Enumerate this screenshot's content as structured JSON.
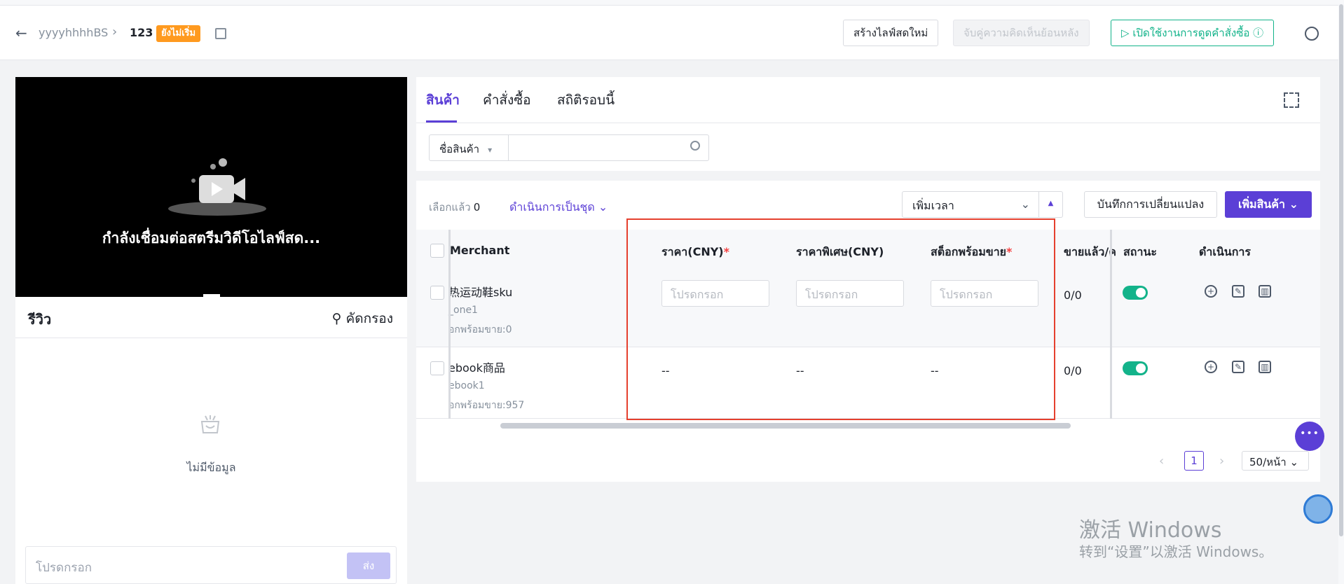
{
  "header": {
    "back_icon": "arrow-left-icon",
    "crumb_parent": "yyyyhhhhBS",
    "crumb_current": "123",
    "status_badge": "ยังไม่เริ่ม",
    "buttons": {
      "new_live": "สร้างไลฟ์สดใหม่",
      "match_feedback": "จับคู่ความคิดเห็นย้อนหลัง",
      "enable_order": "เปิดใช้งานการดูดคำสั่งซื้อ"
    }
  },
  "video": {
    "connecting_text": "กำลังเชื่อมต่อสตรีมวิดีโอไลฟ์สด..."
  },
  "review": {
    "title": "รีวิว",
    "filter_label": "คัดกรอง",
    "empty_text": "ไม่มีข้อมูล",
    "input_placeholder": "โปรดกรอก",
    "send_label": "ส่ง"
  },
  "tabs": [
    {
      "label": "สินค้า",
      "active": true
    },
    {
      "label": "คำสั่งซื้อ",
      "active": false
    },
    {
      "label": "สถิติรอบนี้",
      "active": false
    }
  ],
  "search": {
    "field_select": "ชื่อสินค้า",
    "value": ""
  },
  "toolbar": {
    "selected_label": "เลือกแล้ว",
    "selected_count": "0",
    "batch_label": "ดำเนินการเป็นชุด",
    "time_select": "เพิ่มเวลา",
    "save_label": "บันทึกการเปลี่ยนแปลง",
    "add_label": "เพิ่มสินค้า"
  },
  "table": {
    "columns": {
      "merchant": "Merchant",
      "price": "ราคา(CNY)",
      "special_price": "ราคาพิเศษ(CNY)",
      "stock": "สต็อกพร้อมขาย",
      "sold": "ขายแล้ว/ค",
      "status": "สถานะ",
      "actions": "ดำเนินการ"
    },
    "rows": [
      {
        "name": "热运动鞋sku",
        "sub": "_one1",
        "stock_text": "อกพร้อมขาย:0",
        "price": "โปรดกรอก",
        "special_price": "โปรดกรอก",
        "stock": "โปรดกรอก",
        "sold": "0/0",
        "enabled": true
      },
      {
        "name": "ebook商品",
        "sub": "ebook1",
        "stock_text": "อกพร้อมขาย:957",
        "price": "--",
        "special_price": "--",
        "stock": "--",
        "sold": "0/0",
        "enabled": true
      }
    ]
  },
  "pagination": {
    "page": "1",
    "page_size": "50/หน้า"
  },
  "watermark": {
    "line1": "激活 Windows",
    "line2": "转到“设置”以激活 Windows。"
  },
  "colors": {
    "brand": "#5b3fd6",
    "success": "#13b38a",
    "warning": "#ff9a1f",
    "highlight": "#e5402e"
  }
}
